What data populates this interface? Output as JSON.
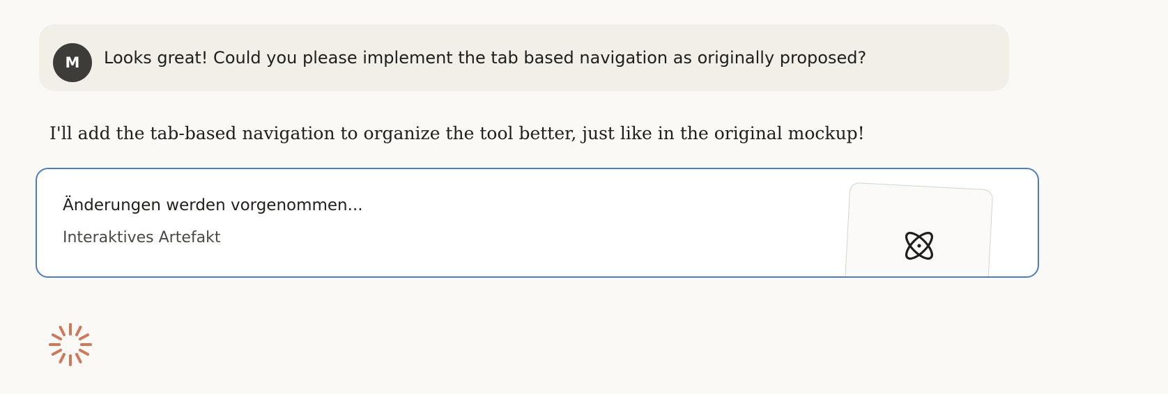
{
  "user_message": {
    "avatar_initial": "M",
    "text": "Looks great! Could you please implement the tab based navigation as originally proposed?"
  },
  "assistant_message": {
    "text": "I'll add the tab-based navigation to organize the tool better, just like in the original mockup!"
  },
  "artifact": {
    "title": "Änderungen werden vorgenommen...",
    "subtitle": "Interaktives Artefakt",
    "preview_icon": "atom-icon"
  },
  "status": {
    "icon": "loading-spinner-icon"
  },
  "colors": {
    "background": "#faf9f6",
    "user_bubble": "#f1efe8",
    "avatar": "#3d3c38",
    "artifact_border": "#4a7dc0",
    "spinner": "#d0775a"
  }
}
